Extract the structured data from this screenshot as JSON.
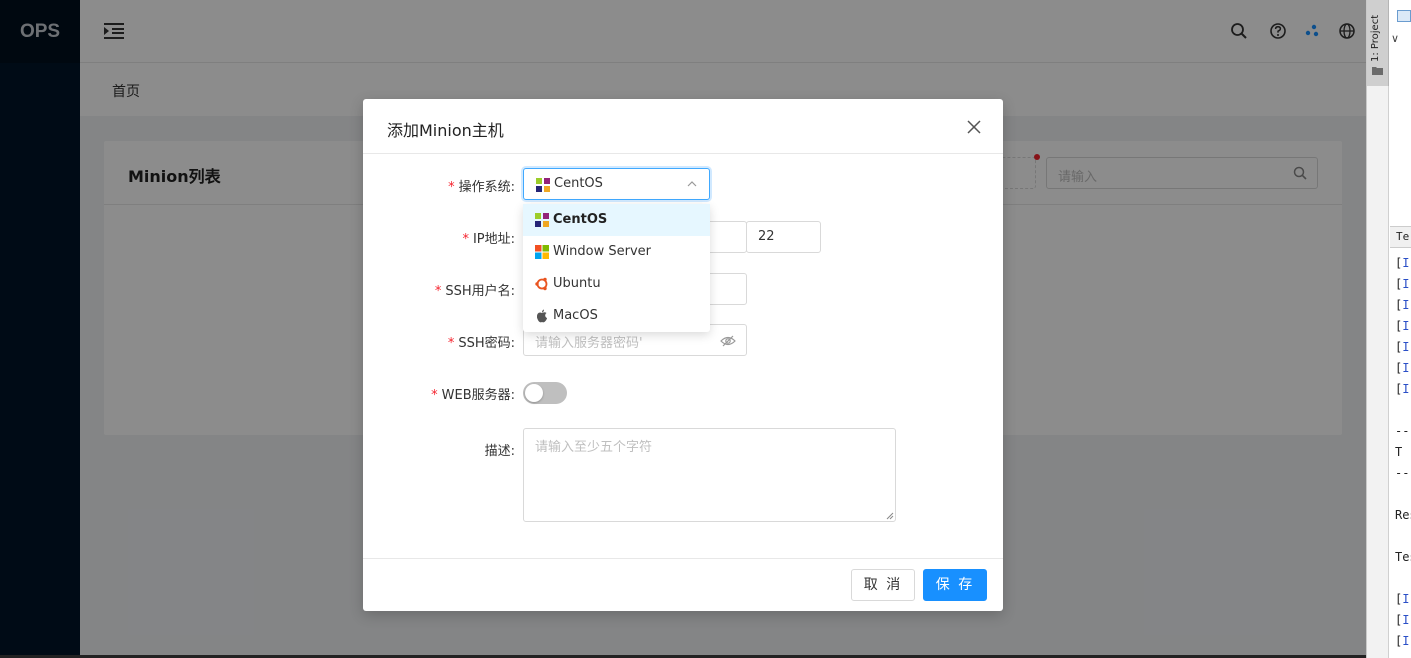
{
  "sidebar": {
    "logo": "OPS"
  },
  "breadcrumb": {
    "home": "首页"
  },
  "card": {
    "title": "Minion列表",
    "search_placeholder": "请输入"
  },
  "modal": {
    "title": "添加Minion主机",
    "fields": {
      "os": {
        "label": "操作系统:",
        "selected": "CentOS"
      },
      "ip": {
        "label": "IP地址:",
        "port_value": "22"
      },
      "ssh_user": {
        "label": "SSH用户名:"
      },
      "ssh_password": {
        "label": "SSH密码:",
        "placeholder": "请输入服务器密码'"
      },
      "web_server": {
        "label": "WEB服务器:",
        "enabled": false
      },
      "description": {
        "label": "描述:",
        "placeholder": "请输入至少五个字符"
      }
    },
    "os_options": [
      {
        "label": "CentOS",
        "icon": "centos-icon",
        "active": true
      },
      {
        "label": "Window Server",
        "icon": "windows-icon",
        "active": false
      },
      {
        "label": "Ubuntu",
        "icon": "ubuntu-icon",
        "active": false
      },
      {
        "label": "MacOS",
        "icon": "apple-icon",
        "active": false
      }
    ],
    "footer": {
      "cancel": "取 消",
      "save": "保 存"
    }
  },
  "ide": {
    "tab": "1: Project",
    "panel_header": "Te",
    "log_lines": [
      "[I",
      "[I",
      "[I",
      "[I",
      "[I",
      "[I",
      "[I",
      "--",
      " T",
      "--",
      "Res",
      "Tes",
      "[I",
      "[I",
      "[I"
    ]
  },
  "colors": {
    "primary": "#1890ff",
    "required": "#f5222d",
    "sidebar": "#001529"
  }
}
